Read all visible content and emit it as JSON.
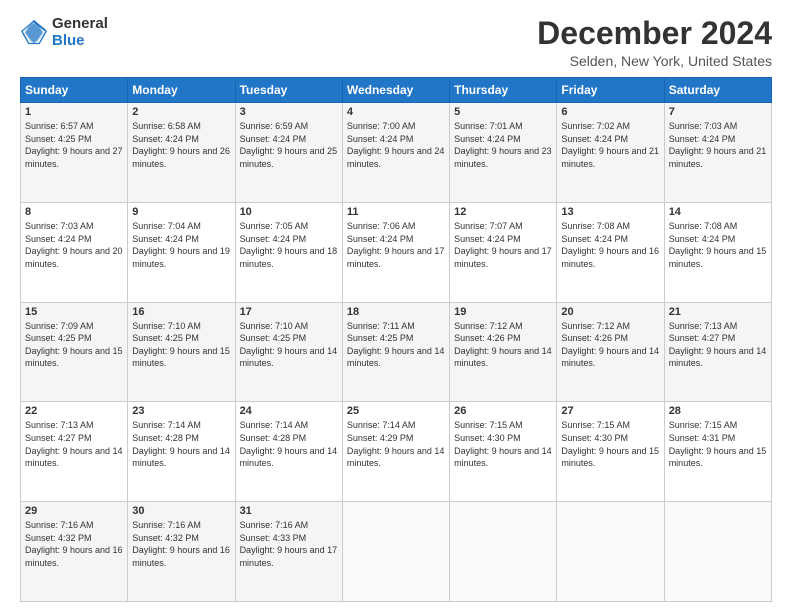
{
  "logo": {
    "general": "General",
    "blue": "Blue"
  },
  "title": "December 2024",
  "location": "Selden, New York, United States",
  "days_of_week": [
    "Sunday",
    "Monday",
    "Tuesday",
    "Wednesday",
    "Thursday",
    "Friday",
    "Saturday"
  ],
  "weeks": [
    [
      {
        "day": "1",
        "sunrise": "6:57 AM",
        "sunset": "4:25 PM",
        "daylight": "9 hours and 27 minutes."
      },
      {
        "day": "2",
        "sunrise": "6:58 AM",
        "sunset": "4:24 PM",
        "daylight": "9 hours and 26 minutes."
      },
      {
        "day": "3",
        "sunrise": "6:59 AM",
        "sunset": "4:24 PM",
        "daylight": "9 hours and 25 minutes."
      },
      {
        "day": "4",
        "sunrise": "7:00 AM",
        "sunset": "4:24 PM",
        "daylight": "9 hours and 24 minutes."
      },
      {
        "day": "5",
        "sunrise": "7:01 AM",
        "sunset": "4:24 PM",
        "daylight": "9 hours and 23 minutes."
      },
      {
        "day": "6",
        "sunrise": "7:02 AM",
        "sunset": "4:24 PM",
        "daylight": "9 hours and 21 minutes."
      },
      {
        "day": "7",
        "sunrise": "7:03 AM",
        "sunset": "4:24 PM",
        "daylight": "9 hours and 21 minutes."
      }
    ],
    [
      {
        "day": "8",
        "sunrise": "7:03 AM",
        "sunset": "4:24 PM",
        "daylight": "9 hours and 20 minutes."
      },
      {
        "day": "9",
        "sunrise": "7:04 AM",
        "sunset": "4:24 PM",
        "daylight": "9 hours and 19 minutes."
      },
      {
        "day": "10",
        "sunrise": "7:05 AM",
        "sunset": "4:24 PM",
        "daylight": "9 hours and 18 minutes."
      },
      {
        "day": "11",
        "sunrise": "7:06 AM",
        "sunset": "4:24 PM",
        "daylight": "9 hours and 17 minutes."
      },
      {
        "day": "12",
        "sunrise": "7:07 AM",
        "sunset": "4:24 PM",
        "daylight": "9 hours and 17 minutes."
      },
      {
        "day": "13",
        "sunrise": "7:08 AM",
        "sunset": "4:24 PM",
        "daylight": "9 hours and 16 minutes."
      },
      {
        "day": "14",
        "sunrise": "7:08 AM",
        "sunset": "4:24 PM",
        "daylight": "9 hours and 15 minutes."
      }
    ],
    [
      {
        "day": "15",
        "sunrise": "7:09 AM",
        "sunset": "4:25 PM",
        "daylight": "9 hours and 15 minutes."
      },
      {
        "day": "16",
        "sunrise": "7:10 AM",
        "sunset": "4:25 PM",
        "daylight": "9 hours and 15 minutes."
      },
      {
        "day": "17",
        "sunrise": "7:10 AM",
        "sunset": "4:25 PM",
        "daylight": "9 hours and 14 minutes."
      },
      {
        "day": "18",
        "sunrise": "7:11 AM",
        "sunset": "4:25 PM",
        "daylight": "9 hours and 14 minutes."
      },
      {
        "day": "19",
        "sunrise": "7:12 AM",
        "sunset": "4:26 PM",
        "daylight": "9 hours and 14 minutes."
      },
      {
        "day": "20",
        "sunrise": "7:12 AM",
        "sunset": "4:26 PM",
        "daylight": "9 hours and 14 minutes."
      },
      {
        "day": "21",
        "sunrise": "7:13 AM",
        "sunset": "4:27 PM",
        "daylight": "9 hours and 14 minutes."
      }
    ],
    [
      {
        "day": "22",
        "sunrise": "7:13 AM",
        "sunset": "4:27 PM",
        "daylight": "9 hours and 14 minutes."
      },
      {
        "day": "23",
        "sunrise": "7:14 AM",
        "sunset": "4:28 PM",
        "daylight": "9 hours and 14 minutes."
      },
      {
        "day": "24",
        "sunrise": "7:14 AM",
        "sunset": "4:28 PM",
        "daylight": "9 hours and 14 minutes."
      },
      {
        "day": "25",
        "sunrise": "7:14 AM",
        "sunset": "4:29 PM",
        "daylight": "9 hours and 14 minutes."
      },
      {
        "day": "26",
        "sunrise": "7:15 AM",
        "sunset": "4:30 PM",
        "daylight": "9 hours and 14 minutes."
      },
      {
        "day": "27",
        "sunrise": "7:15 AM",
        "sunset": "4:30 PM",
        "daylight": "9 hours and 15 minutes."
      },
      {
        "day": "28",
        "sunrise": "7:15 AM",
        "sunset": "4:31 PM",
        "daylight": "9 hours and 15 minutes."
      }
    ],
    [
      {
        "day": "29",
        "sunrise": "7:16 AM",
        "sunset": "4:32 PM",
        "daylight": "9 hours and 16 minutes."
      },
      {
        "day": "30",
        "sunrise": "7:16 AM",
        "sunset": "4:32 PM",
        "daylight": "9 hours and 16 minutes."
      },
      {
        "day": "31",
        "sunrise": "7:16 AM",
        "sunset": "4:33 PM",
        "daylight": "9 hours and 17 minutes."
      },
      null,
      null,
      null,
      null
    ]
  ],
  "labels": {
    "sunrise": "Sunrise:",
    "sunset": "Sunset:",
    "daylight": "Daylight:"
  }
}
